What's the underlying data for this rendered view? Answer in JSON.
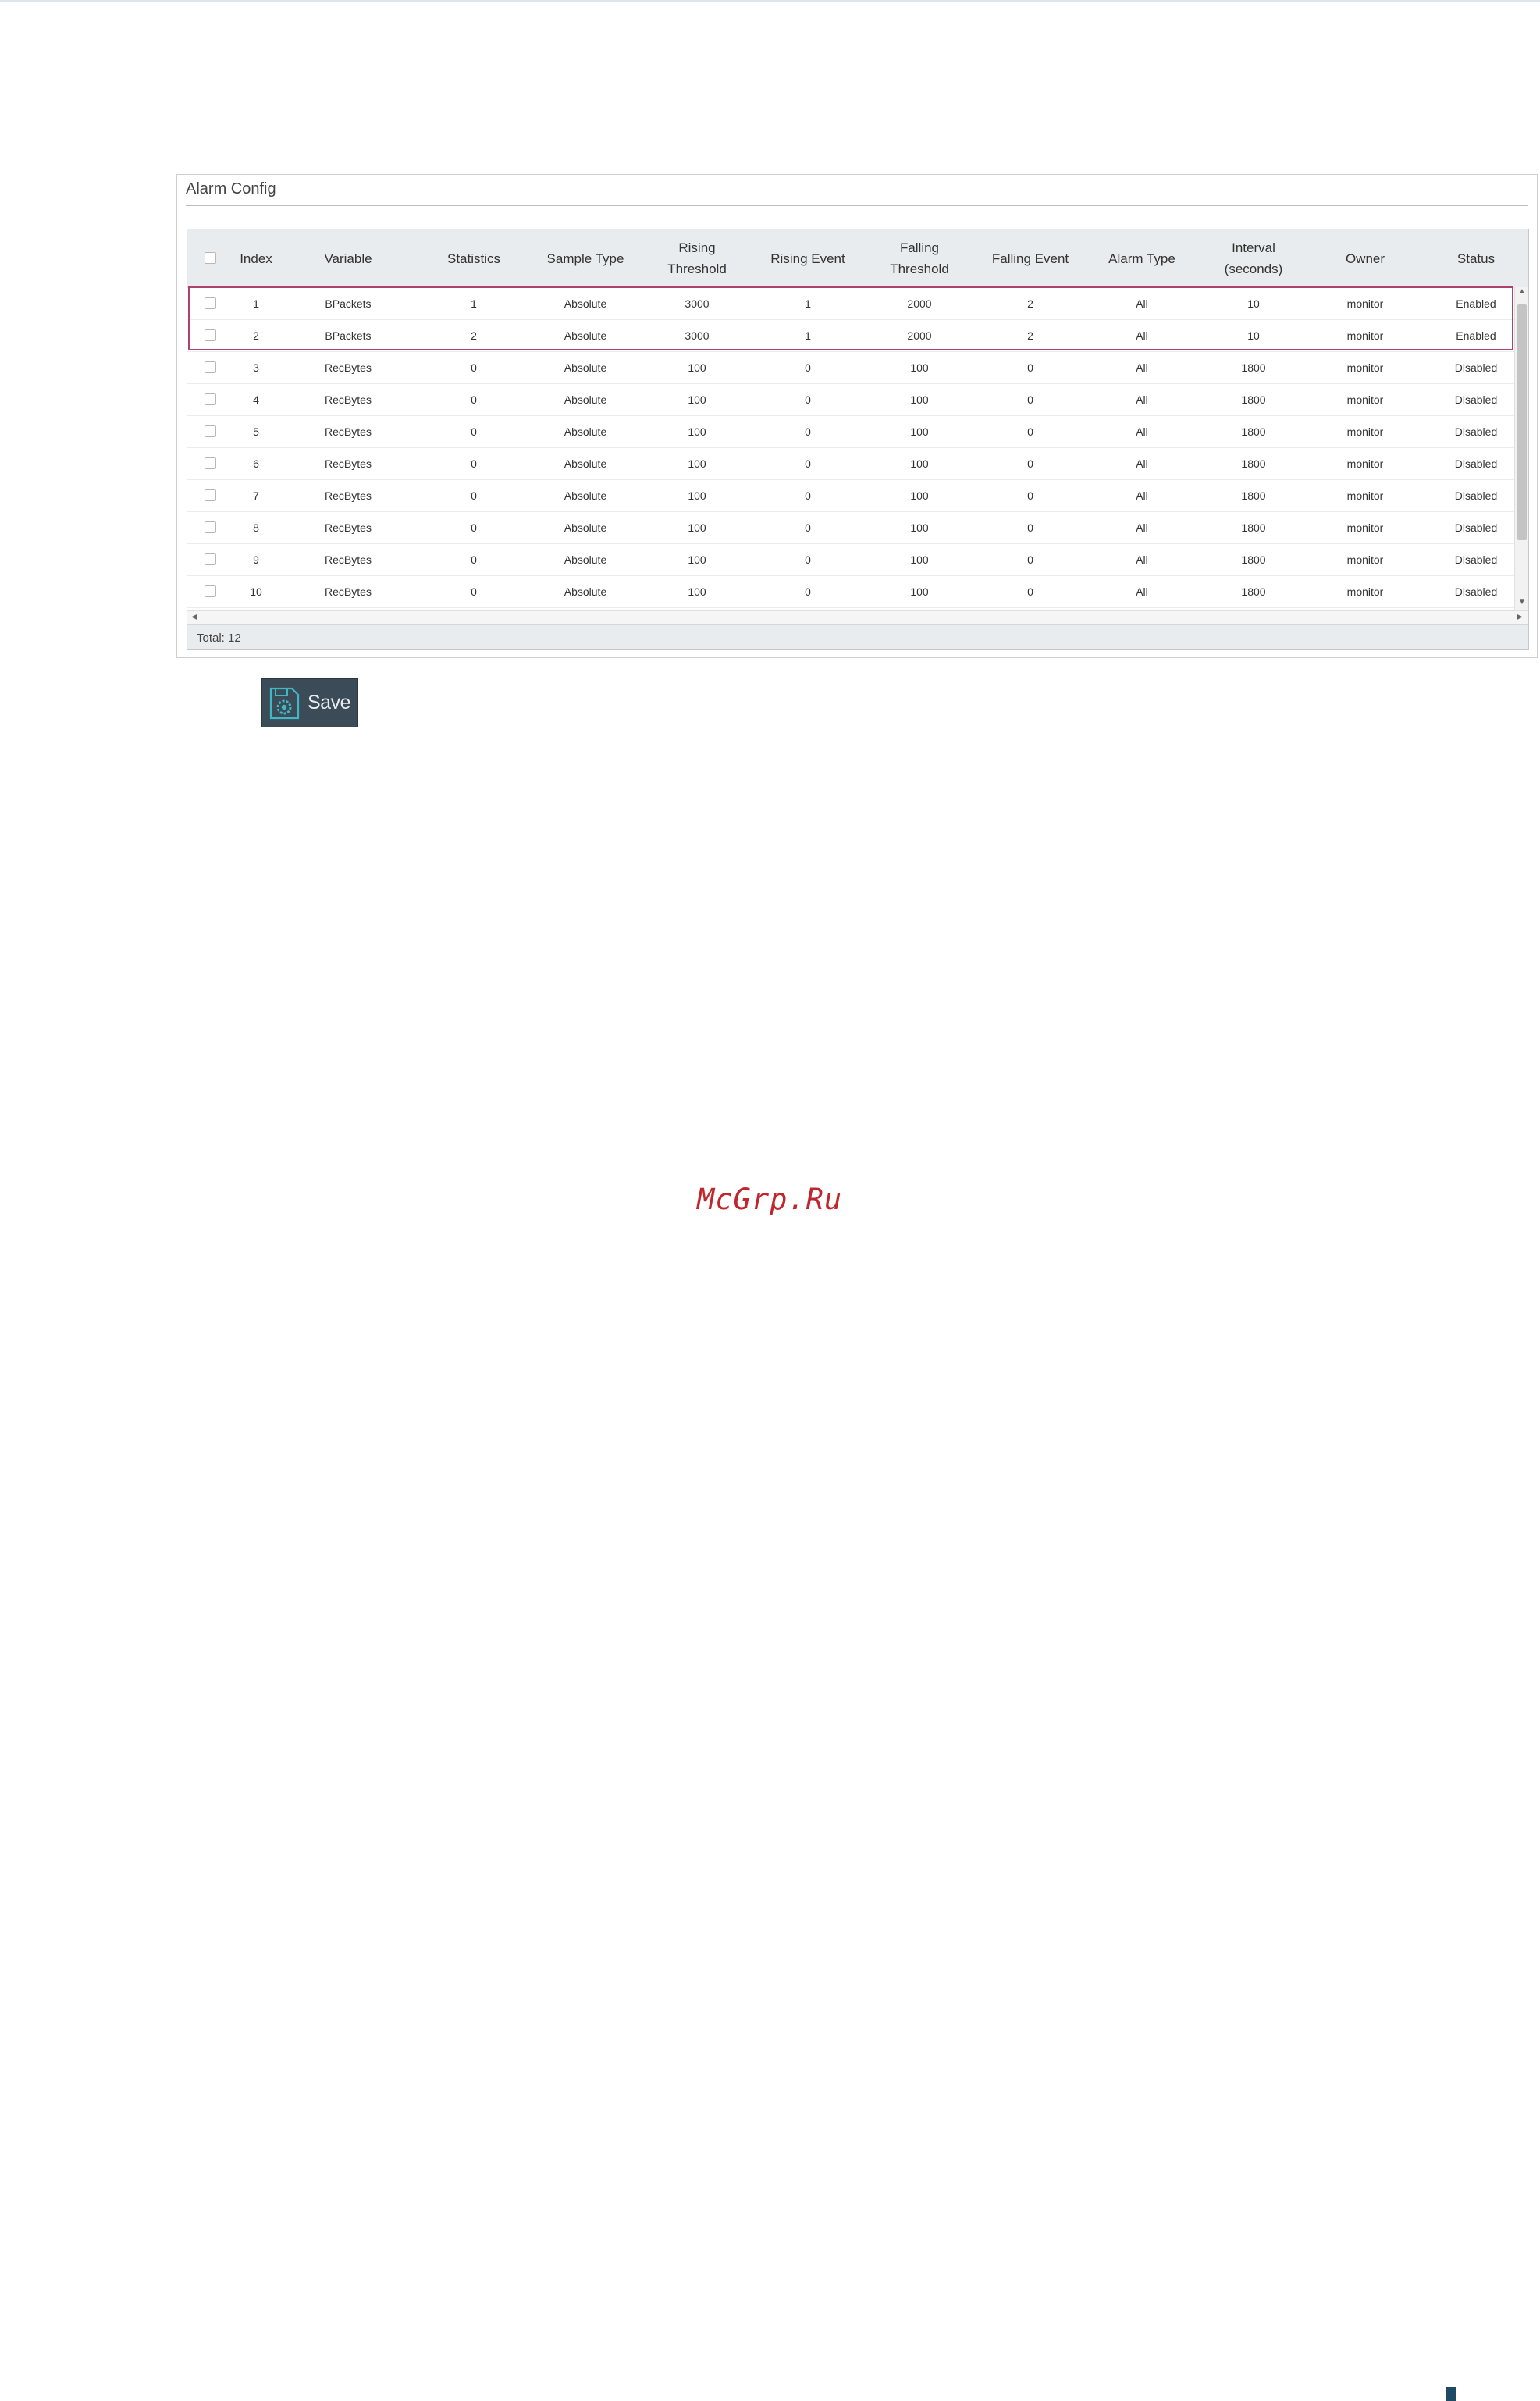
{
  "panel": {
    "title": "Alarm Config"
  },
  "table": {
    "columns": [
      {
        "key": "index",
        "label": "Index"
      },
      {
        "key": "variable",
        "label": "Variable"
      },
      {
        "key": "statistics",
        "label": "Statistics"
      },
      {
        "key": "sample_type",
        "label": "Sample Type"
      },
      {
        "key": "rising_threshold",
        "label": "Rising\nThreshold"
      },
      {
        "key": "rising_event",
        "label": "Rising Event"
      },
      {
        "key": "falling_threshold",
        "label": "Falling\nThreshold"
      },
      {
        "key": "falling_event",
        "label": "Falling Event"
      },
      {
        "key": "alarm_type",
        "label": "Alarm Type"
      },
      {
        "key": "interval",
        "label": "Interval\n(seconds)"
      },
      {
        "key": "owner",
        "label": "Owner"
      },
      {
        "key": "status",
        "label": "Status"
      }
    ],
    "rows": [
      [
        "1",
        "BPackets",
        "1",
        "Absolute",
        "3000",
        "1",
        "2000",
        "2",
        "All",
        "10",
        "monitor",
        "Enabled"
      ],
      [
        "2",
        "BPackets",
        "2",
        "Absolute",
        "3000",
        "1",
        "2000",
        "2",
        "All",
        "10",
        "monitor",
        "Enabled"
      ],
      [
        "3",
        "RecBytes",
        "0",
        "Absolute",
        "100",
        "0",
        "100",
        "0",
        "All",
        "1800",
        "monitor",
        "Disabled"
      ],
      [
        "4",
        "RecBytes",
        "0",
        "Absolute",
        "100",
        "0",
        "100",
        "0",
        "All",
        "1800",
        "monitor",
        "Disabled"
      ],
      [
        "5",
        "RecBytes",
        "0",
        "Absolute",
        "100",
        "0",
        "100",
        "0",
        "All",
        "1800",
        "monitor",
        "Disabled"
      ],
      [
        "6",
        "RecBytes",
        "0",
        "Absolute",
        "100",
        "0",
        "100",
        "0",
        "All",
        "1800",
        "monitor",
        "Disabled"
      ],
      [
        "7",
        "RecBytes",
        "0",
        "Absolute",
        "100",
        "0",
        "100",
        "0",
        "All",
        "1800",
        "monitor",
        "Disabled"
      ],
      [
        "8",
        "RecBytes",
        "0",
        "Absolute",
        "100",
        "0",
        "100",
        "0",
        "All",
        "1800",
        "monitor",
        "Disabled"
      ],
      [
        "9",
        "RecBytes",
        "0",
        "Absolute",
        "100",
        "0",
        "100",
        "0",
        "All",
        "1800",
        "monitor",
        "Disabled"
      ],
      [
        "10",
        "RecBytes",
        "0",
        "Absolute",
        "100",
        "0",
        "100",
        "0",
        "All",
        "1800",
        "monitor",
        "Disabled"
      ]
    ],
    "total": "Total: 12"
  },
  "toolbar": {
    "save_label": "Save",
    "save_icon": "save-gear-icon"
  },
  "watermark": {
    "text": "McGrp.Ru"
  },
  "colors": {
    "highlight": "#b0406e",
    "save_bg": "#3b4b57",
    "watermark": "#c0272d"
  }
}
